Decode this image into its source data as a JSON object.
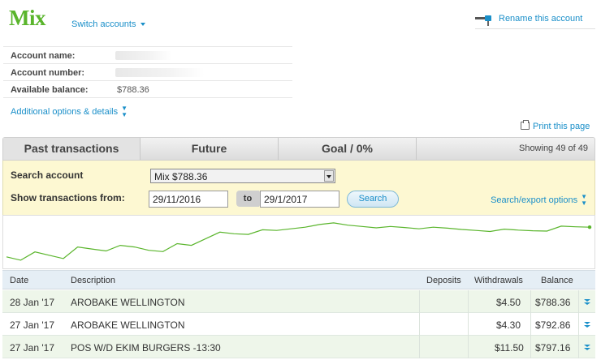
{
  "account": {
    "title": "Mix",
    "switch_label": "Switch accounts",
    "rename_label": "Rename this account",
    "name_label": "Account name:",
    "number_label": "Account number:",
    "balance_label": "Available balance:",
    "balance_value": "$788.36",
    "additional_label": "Additional options & details",
    "print_label": "Print this page"
  },
  "tabs": {
    "items": [
      {
        "label": "Past transactions"
      },
      {
        "label": "Future"
      },
      {
        "label": "Goal / 0%"
      }
    ],
    "showing": "Showing 49 of 49"
  },
  "search": {
    "account_label": "Search account",
    "account_selected": "Mix $788.36",
    "from_label": "Show transactions from:",
    "from_date": "29/11/2016",
    "to_label": "to",
    "to_date": "29/1/2017",
    "search_button": "Search",
    "export_label": "Search/export options"
  },
  "chart_data": {
    "type": "line",
    "series": [
      {
        "color": "#5ab52c",
        "values": [
          2.0,
          1.0,
          3.5,
          2.5,
          1.5,
          5.0,
          4.4,
          3.8,
          5.5,
          5.0,
          4.0,
          3.6,
          6.0,
          5.5,
          7.5,
          9.5,
          9.0,
          8.8,
          10.2,
          10.0,
          10.5,
          11.0,
          11.8,
          12.3,
          11.6,
          11.2,
          10.8,
          11.2,
          10.9,
          10.5,
          11.0,
          10.7,
          10.3,
          10.0,
          9.7,
          10.4,
          10.1,
          9.9,
          9.8,
          11.3,
          11.1,
          11.0
        ]
      }
    ],
    "ylim": [
      0,
      13
    ],
    "grid": false
  },
  "table": {
    "headers": {
      "date": "Date",
      "description": "Description",
      "deposits": "Deposits",
      "withdrawals": "Withdrawals",
      "balance": "Balance"
    },
    "rows": [
      {
        "date": "28 Jan '17",
        "description": "AROBAKE WELLINGTON",
        "deposits": "",
        "withdrawals": "$4.50",
        "balance": "$788.36"
      },
      {
        "date": "27 Jan '17",
        "description": "AROBAKE WELLINGTON",
        "deposits": "",
        "withdrawals": "$4.30",
        "balance": "$792.86"
      },
      {
        "date": "27 Jan '17",
        "description": "POS W/D EKIM BURGERS -13:30",
        "deposits": "",
        "withdrawals": "$11.50",
        "balance": "$797.16"
      }
    ]
  },
  "colors": {
    "brand_green": "#5ab52c",
    "link_blue": "#1a8fc9",
    "search_panel_bg": "#fdf8d2"
  }
}
